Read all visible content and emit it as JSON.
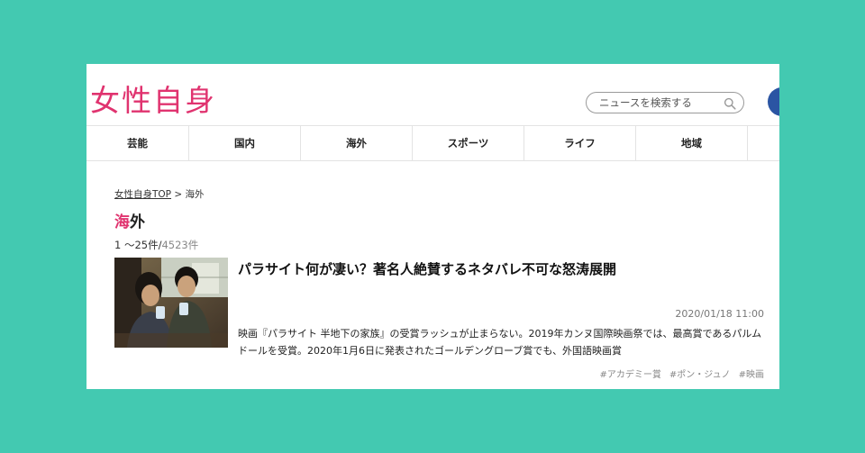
{
  "site": {
    "logo_text": "女性自身",
    "brand_color": "#e0336f",
    "background_color": "#43c9b1"
  },
  "search": {
    "placeholder": "ニュースを検索する",
    "icon": "search-icon"
  },
  "nav": {
    "items": [
      {
        "label": "芸能"
      },
      {
        "label": "国内"
      },
      {
        "label": "海外"
      },
      {
        "label": "スポーツ"
      },
      {
        "label": "ライフ"
      },
      {
        "label": "地域"
      }
    ]
  },
  "breadcrumb": {
    "home": "女性自身TOP",
    "separator": " > ",
    "current": "海外"
  },
  "page_title": {
    "accent": "海",
    "rest": "外"
  },
  "pagination": {
    "range": "1 ～25件/",
    "total": "4523件"
  },
  "article": {
    "title": "パラサイト何が凄い？著名人絶賛するネタバレ不可な怒涛展開",
    "date": "2020/01/18 11:00",
    "summary": "映画『パラサイト 半地下の家族』の受賞ラッシュが止まらない。2019年カンヌ国際映画祭では、最高賞であるパルムドールを受賞。2020年1月6日に発表されたゴールデングローブ賞でも、外国語映画賞",
    "tags": [
      "#アカデミー賞",
      "#ポン・ジュノ",
      "#映画"
    ]
  }
}
